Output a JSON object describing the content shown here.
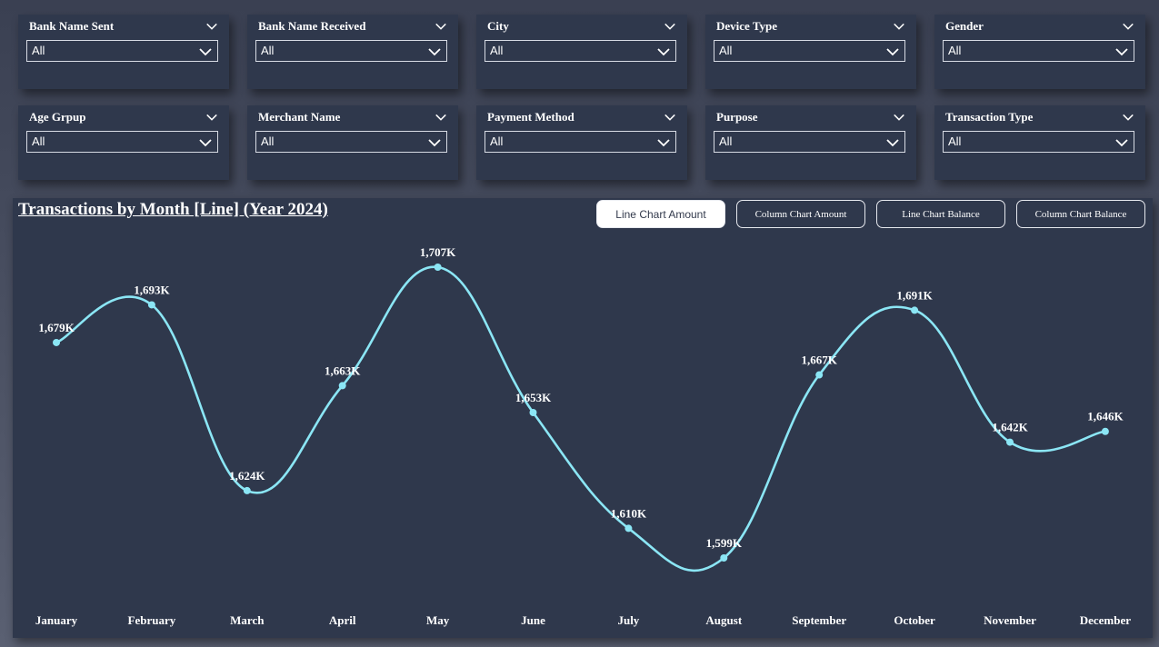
{
  "filters": [
    {
      "label": "Bank Name Sent",
      "value": "All"
    },
    {
      "label": "Bank Name Received",
      "value": "All"
    },
    {
      "label": "City",
      "value": "All"
    },
    {
      "label": "Device Type",
      "value": "All"
    },
    {
      "label": "Gender",
      "value": "All"
    },
    {
      "label": "Age Grpup",
      "value": "All"
    },
    {
      "label": "Merchant Name",
      "value": "All"
    },
    {
      "label": "Payment Method",
      "value": "All"
    },
    {
      "label": "Purpose",
      "value": "All"
    },
    {
      "label": "Transaction Type",
      "value": "All"
    }
  ],
  "buttons": [
    {
      "label": "Line Chart Amount",
      "active": true
    },
    {
      "label": "Column Chart Amount",
      "active": false
    },
    {
      "label": "Line Chart Balance",
      "active": false
    },
    {
      "label": "Column Chart Balance",
      "active": false
    }
  ],
  "colors": {
    "line": "#8be6f5",
    "panel": "#2f384c",
    "background": "#333a4c"
  },
  "icons": {
    "filter_chevron": "chevron-down-icon"
  },
  "chart_data": {
    "type": "line",
    "title": "Transactions by Month [Line] (Year 2024)",
    "categories": [
      "January",
      "February",
      "March",
      "April",
      "May",
      "June",
      "July",
      "August",
      "September",
      "October",
      "November",
      "December"
    ],
    "values": [
      1679,
      1693,
      1624,
      1663,
      1707,
      1653,
      1610,
      1599,
      1667,
      1691,
      1642,
      1646
    ],
    "data_labels": [
      "1,679K",
      "1,693K",
      "1,624K",
      "1,663K",
      "1,707K",
      "1,653K",
      "1,610K",
      "1,599K",
      "1,667K",
      "1,691K",
      "1,642K",
      "1,646K"
    ],
    "xlabel": "",
    "ylabel": "",
    "ylim": [
      1580,
      1720
    ],
    "grid": false,
    "legend": "none"
  }
}
